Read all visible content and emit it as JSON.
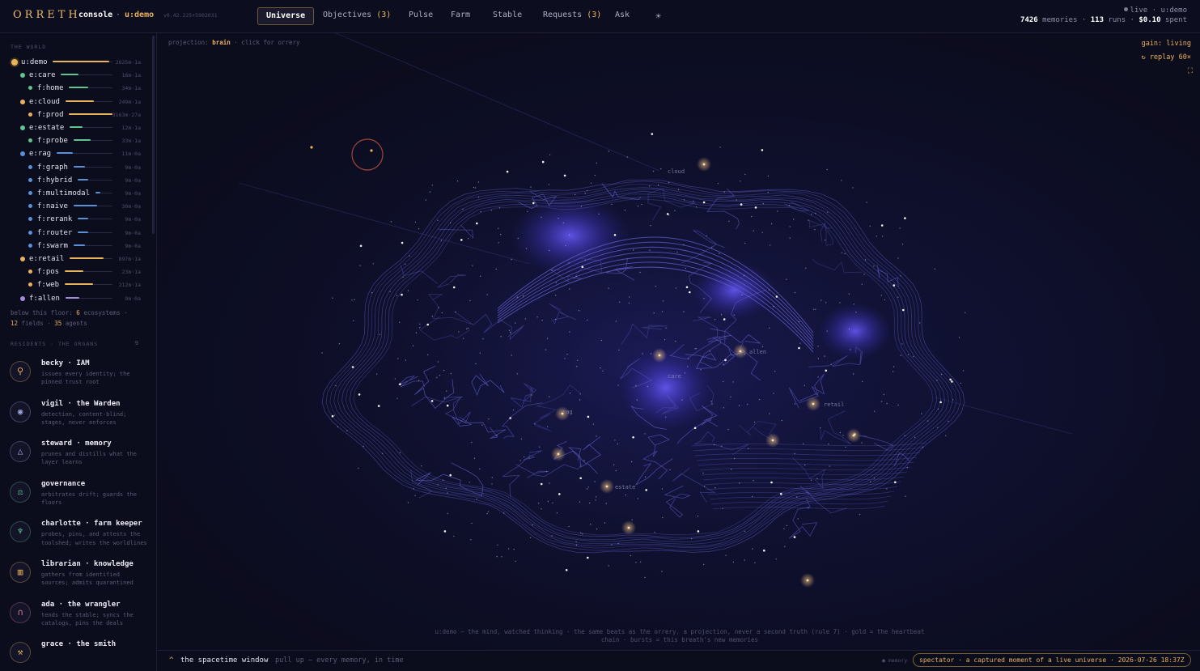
{
  "header": {
    "logo": "ORRETH",
    "console_label": "console",
    "separator": "·",
    "tenant": "u:demo",
    "version": "v0.42.225+5902031",
    "nav": [
      {
        "label": "Universe",
        "count": ""
      },
      {
        "label": "Objectives",
        "count": "(3)"
      },
      {
        "label": "Pulse",
        "count": ""
      },
      {
        "label": "Farm",
        "count": ""
      },
      {
        "label": "Stable",
        "count": ""
      },
      {
        "label": "Requests",
        "count": "(3)"
      },
      {
        "label": "Ask",
        "count": ""
      }
    ],
    "theme_icon": "sun-icon",
    "live_status": "live · u:demo",
    "memories_value": "7426",
    "memories_label": "memories ·",
    "runs_value": "113",
    "runs_label": "runs ·",
    "spent_value": "$0.10",
    "spent_label": "spent"
  },
  "sidebar": {
    "world_heading": "THE WORLD",
    "tree": [
      {
        "name": "u:demo",
        "val": "2625m·1a",
        "color": "#e9b35e",
        "level": 0,
        "fill": 0.95
      },
      {
        "name": "e:care",
        "val": "16m·1a",
        "color": "#5fc48e",
        "level": 1,
        "fill": 0.35
      },
      {
        "name": "f:home",
        "val": "34m·1a",
        "color": "#5fc48e",
        "level": 2,
        "fill": 0.45
      },
      {
        "name": "e:cloud",
        "val": "249m·1a",
        "color": "#e9b35e",
        "level": 1,
        "fill": 0.6
      },
      {
        "name": "f:prod",
        "val": "3163m·27a",
        "color": "#e9b35e",
        "level": 2,
        "fill": 1.0
      },
      {
        "name": "e:estate",
        "val": "12m·1a",
        "color": "#5fc48e",
        "level": 1,
        "fill": 0.3
      },
      {
        "name": "f:probe",
        "val": "33m·1a",
        "color": "#5fc48e",
        "level": 2,
        "fill": 0.45
      },
      {
        "name": "e:rag",
        "val": "11m·0a",
        "color": "#5b8fd8",
        "level": 1,
        "fill": 0.3
      },
      {
        "name": "f:graph",
        "val": "9m·0a",
        "color": "#5b8fd8",
        "level": 2,
        "fill": 0.3
      },
      {
        "name": "f:hybrid",
        "val": "9m·0a",
        "color": "#5b8fd8",
        "level": 2,
        "fill": 0.3
      },
      {
        "name": "f:multimodal",
        "val": "9m·0a",
        "color": "#5b8fd8",
        "level": 2,
        "fill": 0.3
      },
      {
        "name": "f:naive",
        "val": "30m·0a",
        "color": "#5b8fd8",
        "level": 2,
        "fill": 0.6
      },
      {
        "name": "f:rerank",
        "val": "9m·0a",
        "color": "#5b8fd8",
        "level": 2,
        "fill": 0.3
      },
      {
        "name": "f:router",
        "val": "9m·0a",
        "color": "#5b8fd8",
        "level": 2,
        "fill": 0.3
      },
      {
        "name": "f:swarm",
        "val": "9m·0a",
        "color": "#5b8fd8",
        "level": 2,
        "fill": 0.3
      },
      {
        "name": "e:retail",
        "val": "897m·1a",
        "color": "#e9b35e",
        "level": 1,
        "fill": 0.8
      },
      {
        "name": "f:pos",
        "val": "23m·1a",
        "color": "#e9b35e",
        "level": 2,
        "fill": 0.4
      },
      {
        "name": "f:web",
        "val": "212m·1a",
        "color": "#e9b35e",
        "level": 2,
        "fill": 0.6
      },
      {
        "name": "f:allen",
        "val": "9m·0a",
        "color": "#a58be0",
        "level": 1,
        "fill": 0.3
      }
    ],
    "floor_prefix": "below this floor:",
    "floor_ecosystems": "6",
    "floor_ecosystems_label": "ecosystems ·",
    "floor_fields": "12",
    "floor_fields_label": "fields ·",
    "floor_agents": "35",
    "floor_agents_label": "agents",
    "residents_heading": "RESIDENTS · THE ORGANS",
    "residents_count": "9",
    "organs": [
      {
        "title": "becky · IAM",
        "desc": "issues every identity; the pinned trust root",
        "glyph": "⚲",
        "icon": "key-icon",
        "color": "#e9b35e"
      },
      {
        "title": "vigil · the Warden",
        "desc": "detection, content-blind; stages, never enforces",
        "glyph": "◉",
        "icon": "eye-icon",
        "color": "#9aa0d8"
      },
      {
        "title": "steward · memory",
        "desc": "prunes and distills what the layer learns",
        "glyph": "△",
        "icon": "triangle-icon",
        "color": "#9aa0d8"
      },
      {
        "title": "governance",
        "desc": "arbitrates drift; guards the floors",
        "glyph": "⚖",
        "icon": "scales-icon",
        "color": "#5fc48e"
      },
      {
        "title": "charlotte · farm keeper",
        "desc": "probes, pins, and attests the toolshed; writes the worldlines",
        "glyph": "♆",
        "icon": "sprout-icon",
        "color": "#5fc48e"
      },
      {
        "title": "librarian · knowledge",
        "desc": "gathers from identified sources; admits quarantined",
        "glyph": "▥",
        "icon": "book-icon",
        "color": "#e9b35e"
      },
      {
        "title": "ada · the wrangler",
        "desc": "tends the stable; syncs the catalogs, pins the deals",
        "glyph": "∩",
        "icon": "horseshoe-icon",
        "color": "#d87a9a"
      },
      {
        "title": "grace · the smith",
        "desc": "",
        "glyph": "⚒",
        "icon": "anvil-icon",
        "color": "#e9b35e"
      }
    ]
  },
  "main": {
    "projection_label": "projection:",
    "projection_value": "brain",
    "projection_hint": "· click for orrery",
    "gain": "gain: living",
    "replay": "↻ replay 60×",
    "expand_icon": "expand-icon",
    "node_labels": [
      "cloud",
      "allen",
      "care",
      "retail",
      "rag",
      "estate"
    ],
    "caption_line1": "u:demo — the mind, watched thinking · the same beats as the orrery, a projection, never a second truth (rule 7) · gold = the heartbeat",
    "caption_line2": "chain · bursts = this breath's new memories"
  },
  "bottom": {
    "arrow": "^",
    "title": "the spacetime window",
    "subtitle": "pull up — every memory, in time",
    "memory_legend": "● memory",
    "spectator": "spectator · a captured moment of a live universe · 2026-07-26 18:37Z"
  },
  "colors": {
    "accent": "#e9b35e",
    "background": "#0b0c1c",
    "nebula": "#5b52ff",
    "mesh": "#6c6ad8"
  }
}
